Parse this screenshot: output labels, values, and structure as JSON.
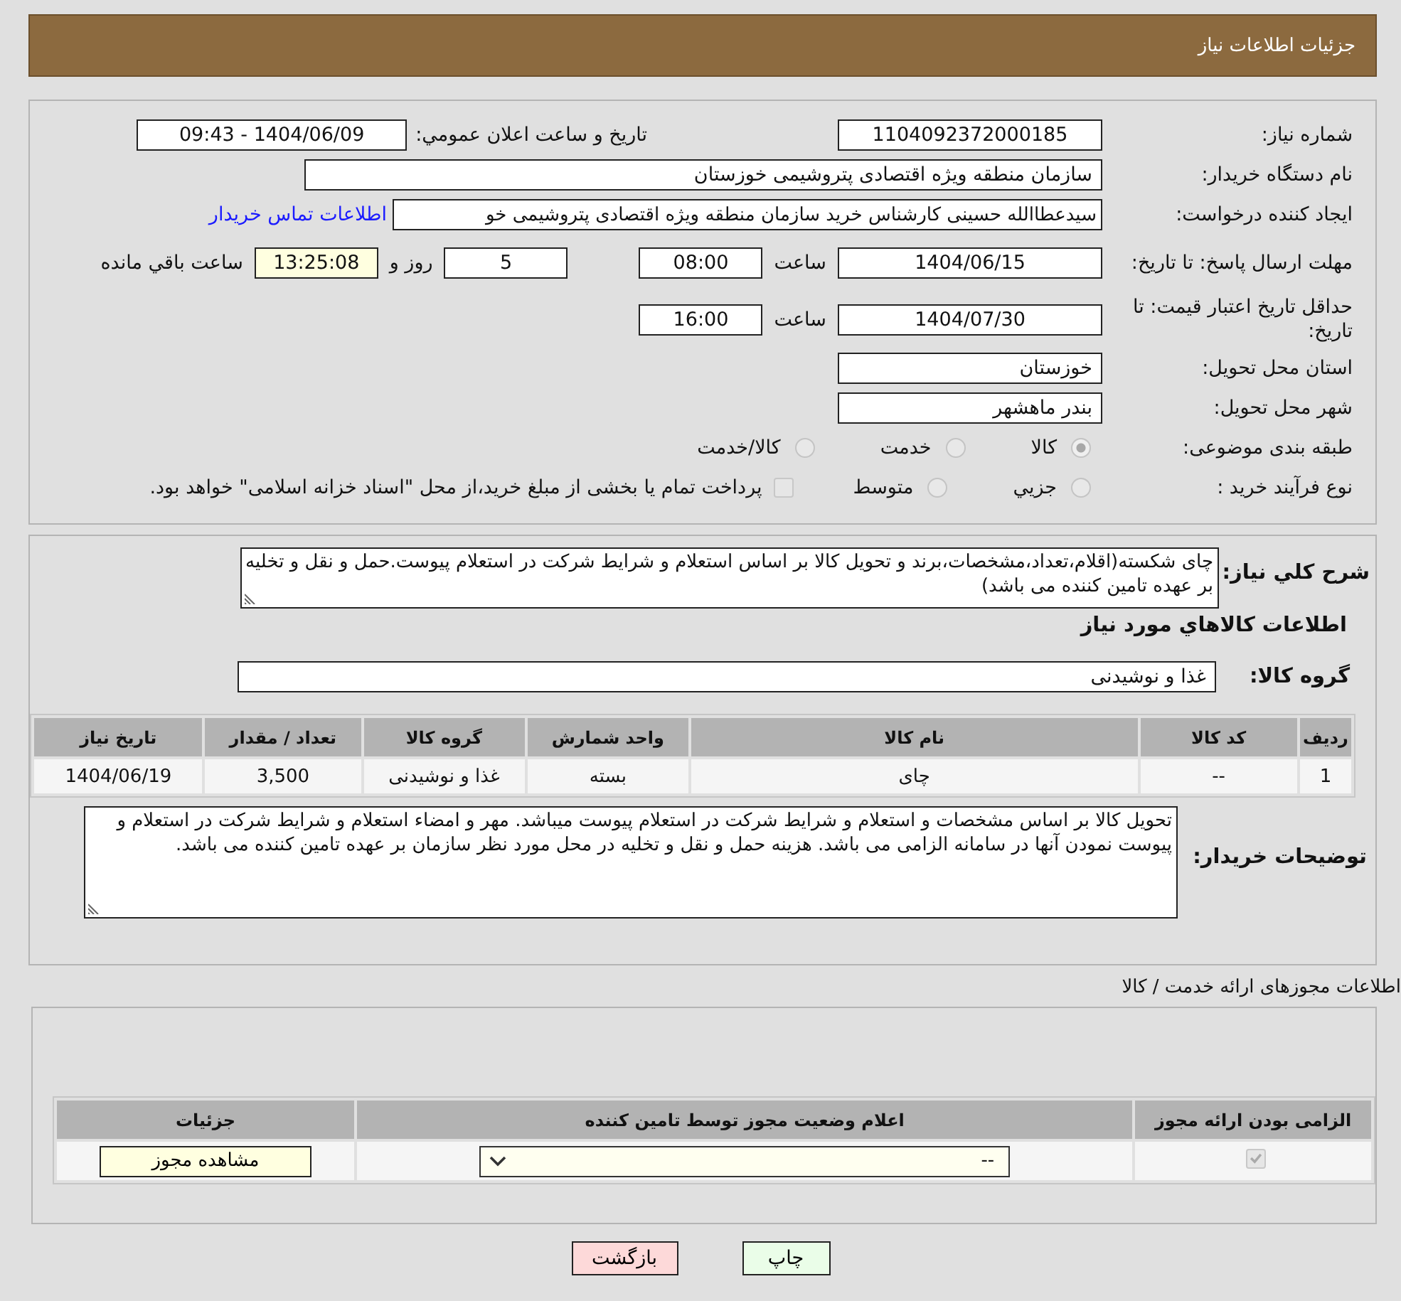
{
  "header": {
    "title": "جزئیات اطلاعات نیاز"
  },
  "need_info": {
    "need_number": {
      "label": "شماره نیاز:",
      "value": "1104092372000185"
    },
    "announce": {
      "label": "تاریخ و ساعت اعلان عمومي:",
      "value": "1404/06/09 - 09:43"
    },
    "buyer": {
      "label": "نام دستگاه خریدار:",
      "value": "سازمان منطقه ویژه اقتصادی پتروشیمی خوزستان"
    },
    "creator": {
      "label": "ایجاد کننده درخواست:",
      "value": "سیدعطاالله حسینی کارشناس خرید سازمان منطقه ویژه اقتصادی پتروشیمی خو",
      "contact_link": "اطلاعات تماس خریدار"
    },
    "deadline": {
      "label": "مهلت ارسال پاسخ: تا تاریخ:",
      "date": "1404/06/15",
      "time_label": "ساعت",
      "time": "08:00",
      "days": "5",
      "days_label": "روز و",
      "remaining": "13:25:08",
      "remaining_label": "ساعت باقي مانده"
    },
    "validity": {
      "label": "حداقل تاریخ اعتبار قیمت: تا تاریخ:",
      "date": "1404/07/30",
      "time_label": "ساعت",
      "time": "16:00"
    },
    "province": {
      "label": "استان محل تحویل:",
      "value": "خوزستان"
    },
    "city": {
      "label": "شهر محل تحویل:",
      "value": "بندر ماهشهر"
    },
    "category": {
      "label": "طبقه بندی موضوعی:",
      "options": [
        {
          "label": "کالا",
          "selected": true
        },
        {
          "label": "خدمت",
          "selected": false
        },
        {
          "label": "کالا/خدمت",
          "selected": false
        }
      ]
    },
    "purchase_type": {
      "label": "نوع فرآیند خرید :",
      "options": [
        {
          "label": "جزيي",
          "selected": false
        },
        {
          "label": "متوسط",
          "selected": false
        }
      ],
      "treasury": {
        "label": "پرداخت تمام یا بخشی از مبلغ خرید،از محل \"اسناد خزانه اسلامی\" خواهد بود.",
        "checked": false
      }
    }
  },
  "description": {
    "label": "شرح کلي نیاز:",
    "value": "چای شکسته(اقلام،تعداد،مشخصات،برند و تحویل کالا بر اساس استعلام  و شرایط شرکت در استعلام پیوست.حمل و نقل و تخلیه بر عهده تامین کننده می باشد)"
  },
  "goods_title": "اطلاعات کالاهاي مورد نیاز",
  "goods_group": {
    "label": "گروه کالا:",
    "value": "غذا و نوشیدنی"
  },
  "goods_table": {
    "columns": [
      "ردیف",
      "کد کالا",
      "نام کالا",
      "واحد شمارش",
      "گروه کالا",
      "تعداد / مقدار",
      "تاریخ نیاز"
    ],
    "rows": [
      [
        "1",
        "--",
        "چای",
        "بسته",
        "غذا و نوشیدنی",
        "3,500",
        "1404/06/19"
      ]
    ]
  },
  "buyer_notes": {
    "label": "توضیحات خریدار:",
    "value": "تحویل کالا بر اساس  مشخصات و استعلام و شرایط شرکت در استعلام پیوست میباشد. مهر و امضاء استعلام و شرایط شرکت در استعلام و پیوست نمودن آنها در سامانه الزامی می باشد. هزینه حمل و نقل و تخلیه در محل مورد نظر سازمان بر عهده تامین کننده می باشد."
  },
  "licenses": {
    "title": "اطلاعات مجوزهای ارائه خدمت / کالا",
    "columns": [
      "الزامی بودن ارائه مجوز",
      "اعلام وضعیت مجوز توسط تامین کننده",
      "جزئیات"
    ],
    "rows": [
      {
        "required": true,
        "status": "--",
        "details_button": "مشاهده مجوز"
      }
    ]
  },
  "buttons": [
    {
      "label": "چاپ",
      "kind": "print"
    },
    {
      "label": "بازگشت",
      "kind": "back"
    }
  ]
}
